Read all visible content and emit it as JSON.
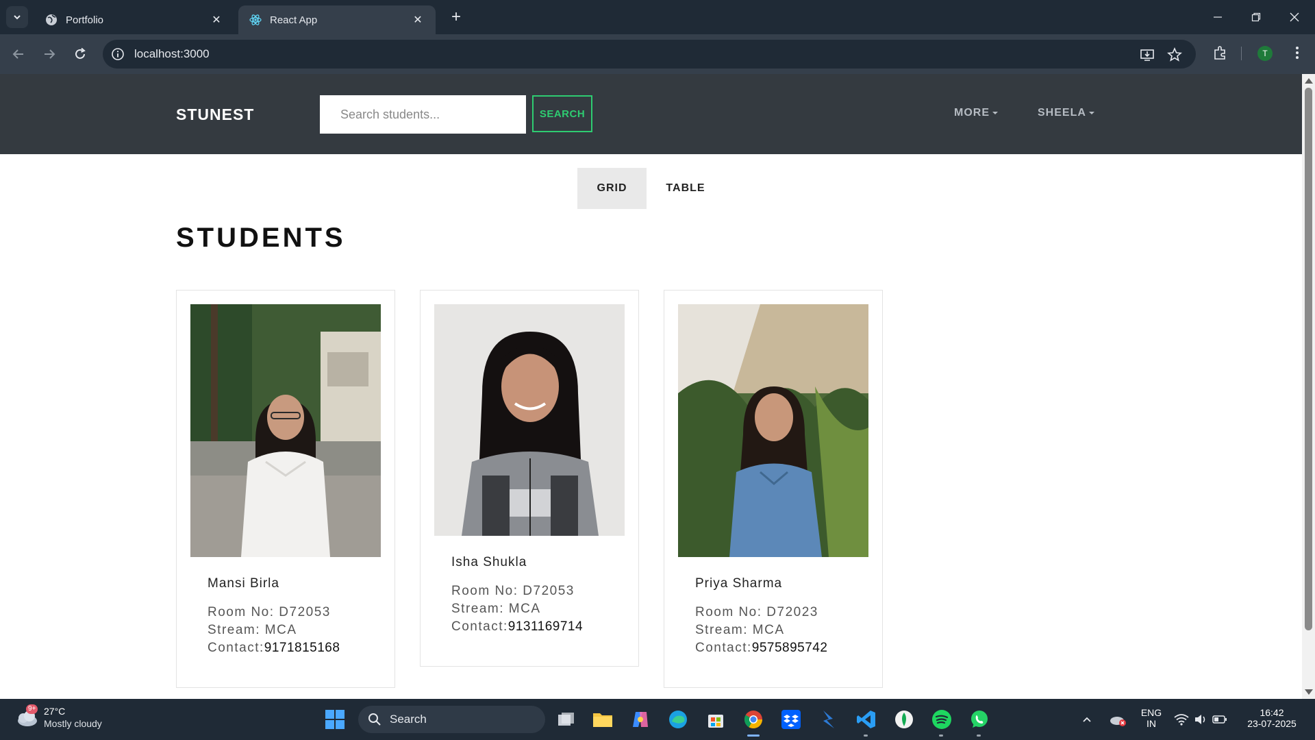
{
  "browser": {
    "tabs": [
      {
        "title": "Portfolio",
        "active": false,
        "icon": "globe-icon"
      },
      {
        "title": "React App",
        "active": true,
        "icon": "react-icon"
      }
    ],
    "url": "localhost:3000",
    "profile_initial": "T"
  },
  "navbar": {
    "brand": "STUNEST",
    "search_placeholder": "Search students...",
    "search_button": "SEARCH",
    "menus": [
      "MORE",
      "SHEELA"
    ]
  },
  "view_toggle": {
    "grid": "GRID",
    "table": "TABLE",
    "selected": "GRID"
  },
  "page_title": "STUDENTS",
  "students": [
    {
      "name": "Mansi Birla",
      "room_label": "Room No: D72053",
      "stream_label": "Stream: MCA",
      "contact_prefix": "Contact:",
      "contact": "9171815168"
    },
    {
      "name": "Isha Shukla",
      "room_label": "Room No: D72053",
      "stream_label": "Stream: MCA",
      "contact_prefix": "Contact:",
      "contact": "9131169714"
    },
    {
      "name": "Priya Sharma",
      "room_label": "Room No: D72023",
      "stream_label": "Stream: MCA",
      "contact_prefix": "Contact:",
      "contact": "9575895742"
    }
  ],
  "taskbar": {
    "weather_badge": "9+",
    "temperature": "27°C",
    "weather": "Mostly cloudy",
    "search_label": "Search",
    "language": "ENG",
    "region": "IN",
    "time": "16:42",
    "date": "23-07-2025"
  },
  "colors": {
    "navbar_bg": "#343a40",
    "search_accent": "#2ecc71",
    "chrome_bg": "#1f2a36"
  }
}
